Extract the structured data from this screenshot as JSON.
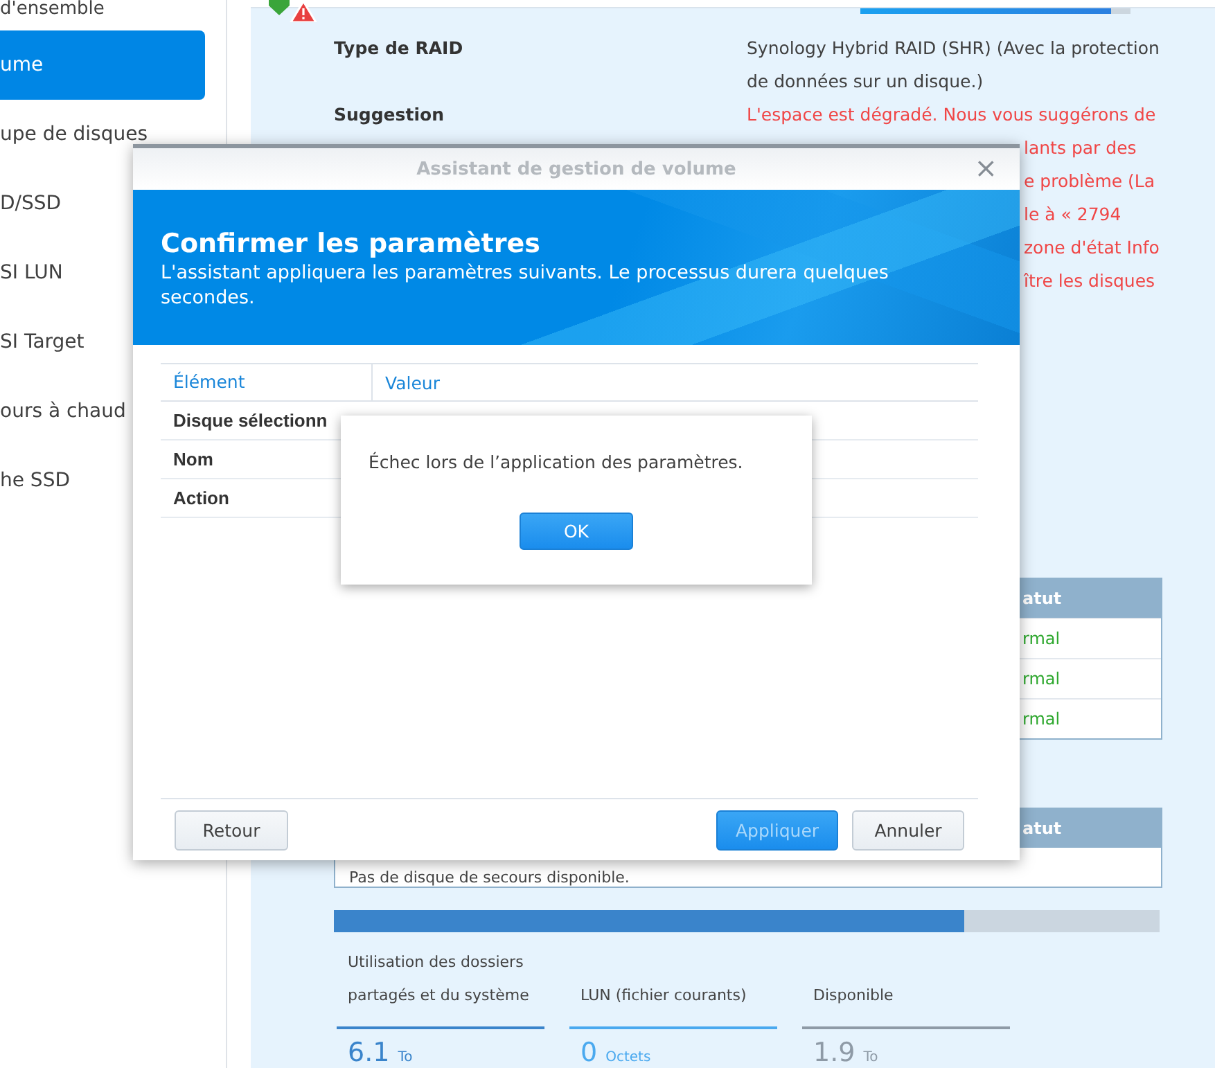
{
  "sidebar": {
    "items": [
      {
        "label": "d'ensemble",
        "selected": false
      },
      {
        "label": "ume",
        "selected": true
      },
      {
        "label": "upe de disques",
        "selected": false
      },
      {
        "label": "D/SSD",
        "selected": false
      },
      {
        "label": "SI LUN",
        "selected": false
      },
      {
        "label": "SI Target",
        "selected": false
      },
      {
        "label": "ours à chaud",
        "selected": false
      },
      {
        "label": "he SSD",
        "selected": false
      }
    ]
  },
  "volume": {
    "progress": {
      "level": 0.93
    },
    "info": [
      {
        "label": "Type de RAID",
        "lines": [
          "Synology Hybrid RAID (SHR) (Avec la protection",
          "de données sur un disque.)"
        ],
        "kind": "normal"
      },
      {
        "label": "Suggestion",
        "lines": [
          "L'espace est dégradé. Nous vous suggérons de",
          "lants par des",
          "e problème (La",
          "le à « 2794",
          "zone d'état Info",
          "ître les disques"
        ],
        "kind": "warning"
      }
    ],
    "disk_table": {
      "column_2": "atut",
      "rows": [
        "rmal",
        "rmal",
        "rmal"
      ]
    },
    "spare_table": {
      "column_2": "atut",
      "rows": [
        "Pas de disque de secours disponible."
      ]
    },
    "usage": {
      "level": 0.764,
      "legend": [
        {
          "label": "Utilisation des dossiers partagés et du système",
          "value": "6.1",
          "unit": "To",
          "color": "#3a84cb"
        },
        {
          "label": "LUN (fichier courants)",
          "value": "0",
          "unit": "Octets",
          "color": "#4aa9ef"
        },
        {
          "label": "Disponible",
          "value": "1.9",
          "unit": "To",
          "color": "#8e9aa6"
        }
      ]
    }
  },
  "wizard": {
    "title": "Assistant de gestion de volume",
    "close": "×",
    "heading": "Confirmer les paramètres",
    "subtitle": "L'assistant appliquera les paramètres suivants. Le processus durera quelques secondes.",
    "columns": [
      "Élément",
      "Valeur"
    ],
    "rows": [
      {
        "label": "Disque sélectionn"
      },
      {
        "label": "Nom"
      },
      {
        "label": "Action"
      }
    ],
    "buttons": [
      {
        "label": "Retour",
        "kind": "plain"
      },
      {
        "label": "Appliquer",
        "kind": "primary"
      },
      {
        "label": "Annuler",
        "kind": "plain"
      }
    ]
  },
  "alert": {
    "message": "Échec lors de l’application des paramètres.",
    "button": "OK"
  }
}
